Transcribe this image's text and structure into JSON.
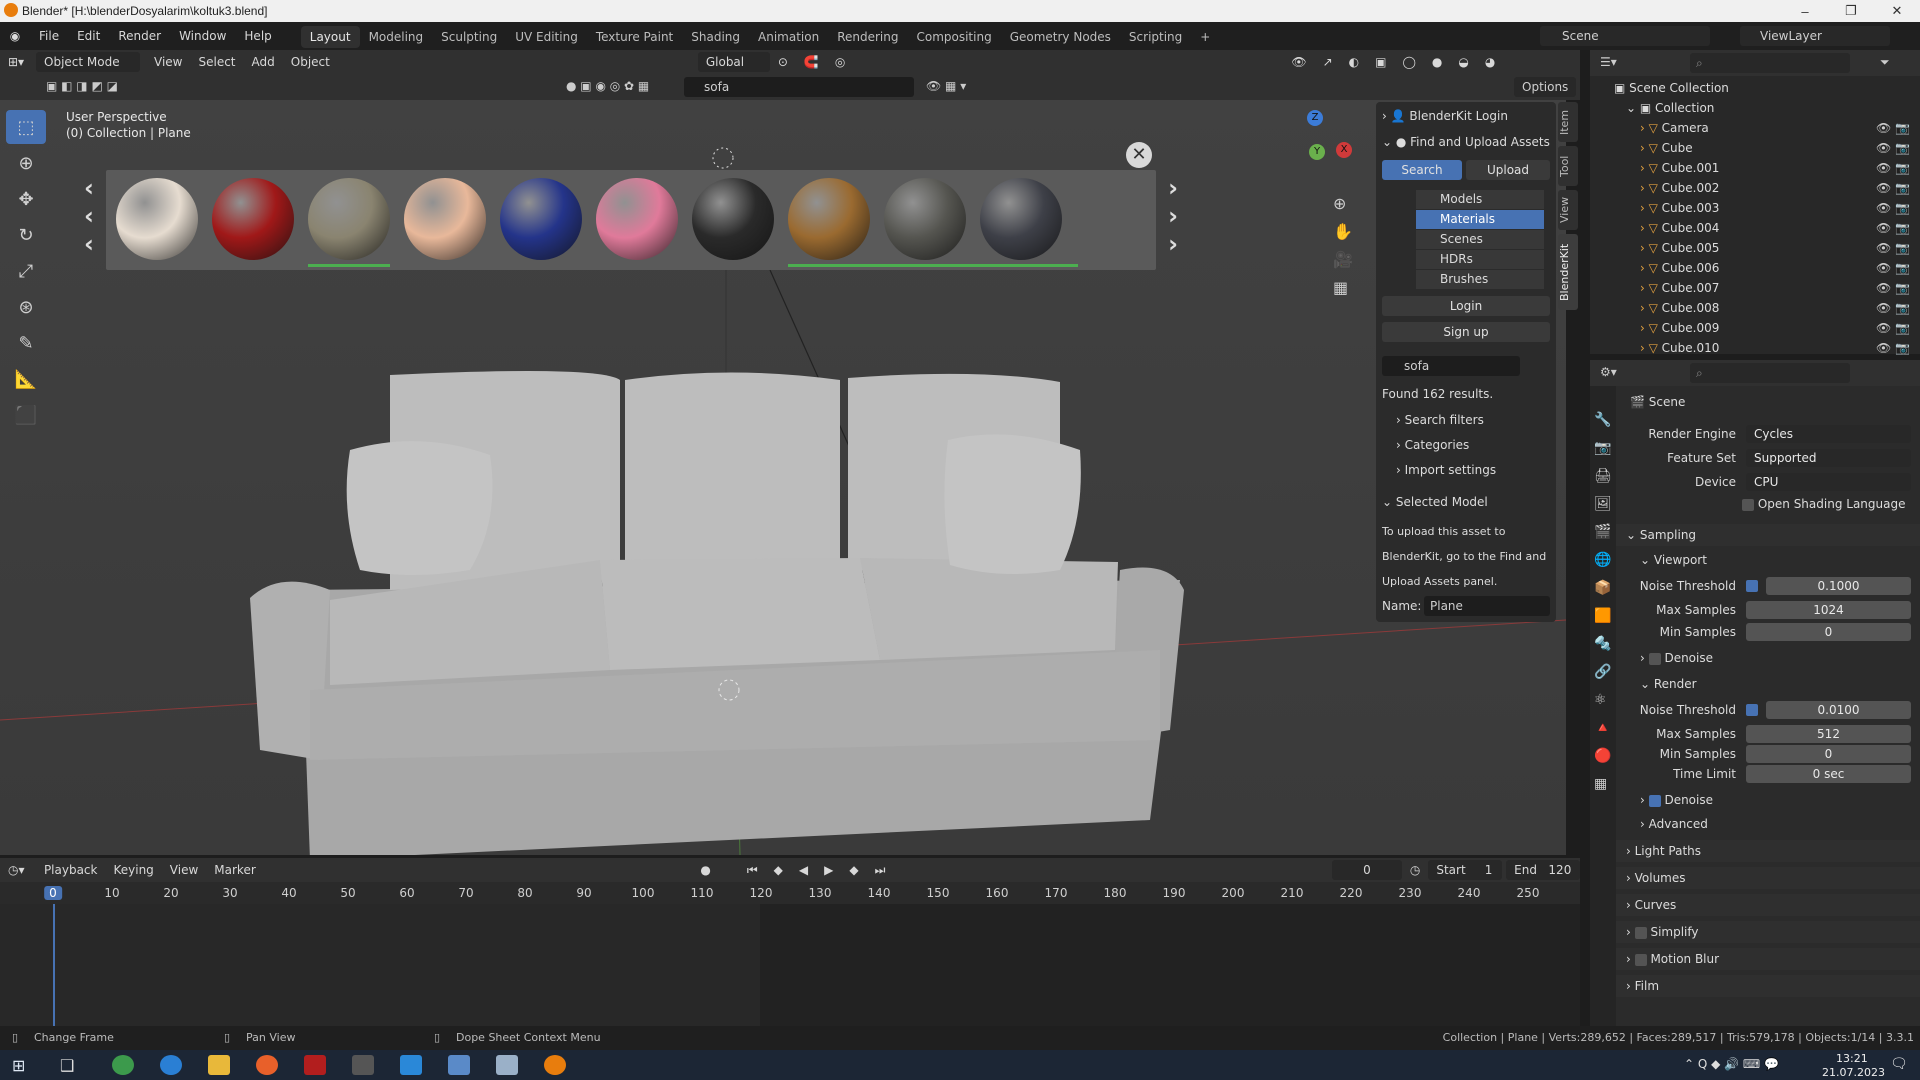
{
  "window": {
    "title": "Blender* [H:\\blenderDosyalarim\\koltuk3.blend]"
  },
  "menu": [
    "File",
    "Edit",
    "Render",
    "Window",
    "Help"
  ],
  "workspaces": [
    "Layout",
    "Modeling",
    "Sculpting",
    "UV Editing",
    "Texture Paint",
    "Shading",
    "Animation",
    "Rendering",
    "Compositing",
    "Geometry Nodes",
    "Scripting"
  ],
  "workspace_add": "+",
  "scene": "Scene",
  "view_layer": "ViewLayer",
  "viewport_header": {
    "mode": "Object Mode",
    "menus": [
      "View",
      "Select",
      "Add",
      "Object"
    ],
    "orientation": "Global",
    "options": "Options",
    "search_value": "sofa"
  },
  "viewport": {
    "perspective": "User Perspective",
    "collection": "(0) Collection | Plane",
    "gizmo_x": "X",
    "gizmo_y": "Y",
    "gizmo_z": "Z"
  },
  "asset_strip": {
    "spheres": [
      {
        "name": "white-marble",
        "color": "#e6dcd0"
      },
      {
        "name": "red-glitter",
        "color": "#a01818"
      },
      {
        "name": "stone-tile",
        "color": "#8a8470"
      },
      {
        "name": "peach-plaster",
        "color": "#e8b89a"
      },
      {
        "name": "blue-fabric",
        "color": "#24348a"
      },
      {
        "name": "pink-plastic",
        "color": "#e07a9a"
      },
      {
        "name": "black-leather",
        "color": "#2a2a2a"
      },
      {
        "name": "brown-leather",
        "color": "#9a6a30"
      },
      {
        "name": "dark-rubber",
        "color": "#555550"
      },
      {
        "name": "dark-metal",
        "color": "#3e4048"
      }
    ],
    "progress_marks": [
      {
        "sphere_index": 2
      },
      {
        "sphere_index": 7
      }
    ]
  },
  "blenderkit": {
    "login_header": "BlenderKit Login",
    "find_upload": "Find and Upload Assets",
    "search_btn": "Search",
    "upload_btn": "Upload",
    "categories": [
      "Models",
      "Materials",
      "Scenes",
      "HDRs",
      "Brushes"
    ],
    "selected_category": "Materials",
    "login_btn": "Login",
    "signup_btn": "Sign up",
    "search_value": "sofa",
    "results": "Found 162 results.",
    "expanders": [
      "Search filters",
      "Categories",
      "Import settings"
    ],
    "selected_model": "Selected Model",
    "upload_hint": [
      "To upload this asset to",
      "BlenderKit, go to the Find and",
      "Upload Assets panel."
    ],
    "name_label": "Name:",
    "name_value": "Plane"
  },
  "side_tabs": [
    "Item",
    "Tool",
    "View",
    "BlenderKit"
  ],
  "outliner": {
    "root": "Scene Collection",
    "collection": "Collection",
    "items": [
      "Camera",
      "Cube",
      "Cube.001",
      "Cube.002",
      "Cube.003",
      "Cube.004",
      "Cube.005",
      "Cube.006",
      "Cube.007",
      "Cube.008",
      "Cube.009",
      "Cube.010"
    ]
  },
  "properties": {
    "context": "Scene",
    "render_engine_label": "Render Engine",
    "render_engine": "Cycles",
    "feature_set_label": "Feature Set",
    "feature_set": "Supported",
    "device_label": "Device",
    "device": "CPU",
    "osl": "Open Shading Language",
    "sampling": "Sampling",
    "viewport": "Viewport",
    "noise_threshold_label": "Noise Threshold",
    "vp_noise": "0.1000",
    "max_samples_label": "Max Samples",
    "vp_max": "1024",
    "min_samples_label": "Min Samples",
    "vp_min": "0",
    "denoise": "Denoise",
    "render": "Render",
    "r_noise": "0.0100",
    "r_max": "512",
    "r_min": "0",
    "time_limit_label": "Time Limit",
    "time_limit": "0 sec",
    "advanced": "Advanced",
    "sections": [
      "Light Paths",
      "Volumes",
      "Curves",
      "Simplify",
      "Motion Blur",
      "Film"
    ]
  },
  "timeline": {
    "menus": [
      "Playback",
      "Keying",
      "View",
      "Marker"
    ],
    "current": "0",
    "start_label": "Start",
    "start": "1",
    "end_label": "End",
    "end": "120",
    "ticks": [
      "0",
      "10",
      "20",
      "30",
      "40",
      "50",
      "60",
      "70",
      "80",
      "90",
      "100",
      "110",
      "120",
      "130",
      "140",
      "150",
      "160",
      "170",
      "180",
      "190",
      "200",
      "210",
      "220",
      "230",
      "240",
      "250"
    ]
  },
  "status": {
    "left1": "Change Frame",
    "left2": "Pan View",
    "left3": "Dope Sheet Context Menu",
    "right": "Collection | Plane | Verts:289,652 | Faces:289,517 | Tris:579,178 | Objects:1/14 | 3.3.1"
  },
  "taskbar": {
    "time": "13:21",
    "date": "21.07.2023"
  },
  "colors": {
    "accent": "#4772b3",
    "green_mark": "#4caf50"
  }
}
